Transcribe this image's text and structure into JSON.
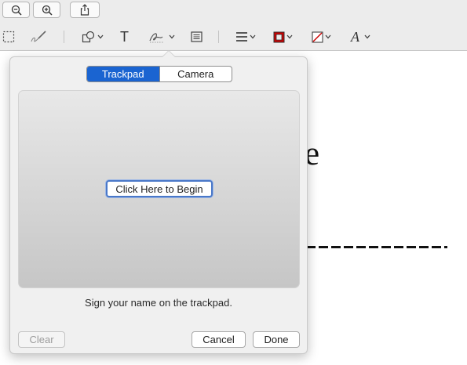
{
  "toolbar": {
    "top_buttons": [
      {
        "name": "zoom-out-button",
        "icon": "zoom-out-icon"
      },
      {
        "name": "zoom-in-button",
        "icon": "zoom-in-icon"
      },
      {
        "name": "share-button",
        "icon": "share-icon"
      }
    ],
    "markup_tools": [
      {
        "name": "selection-tool",
        "icon": "rectangular-selection-icon"
      },
      {
        "name": "sketch-tool",
        "icon": "sketch-pen-icon"
      },
      {
        "name": "shapes-tool",
        "icon": "shapes-icon"
      },
      {
        "name": "text-tool",
        "icon": "text-icon",
        "label": "T"
      },
      {
        "name": "sign-tool",
        "icon": "signature-icon"
      },
      {
        "name": "note-tool",
        "icon": "note-icon"
      },
      {
        "name": "shape-style-tool",
        "icon": "line-style-icon"
      },
      {
        "name": "border-color-tool",
        "icon": "border-color-icon",
        "color": "#cc0000"
      },
      {
        "name": "fill-color-tool",
        "icon": "fill-color-icon",
        "color": "#cc0000"
      },
      {
        "name": "text-style-tool",
        "icon": "text-style-icon",
        "label": "A"
      }
    ]
  },
  "document": {
    "visible_letter": "e"
  },
  "signature_popover": {
    "tabs": [
      {
        "label": "Trackpad",
        "active": true
      },
      {
        "label": "Camera",
        "active": false
      }
    ],
    "begin_button": "Click Here to Begin",
    "instruction": "Sign your name on the trackpad.",
    "clear_button": "Clear",
    "cancel_button": "Cancel",
    "done_button": "Done"
  }
}
